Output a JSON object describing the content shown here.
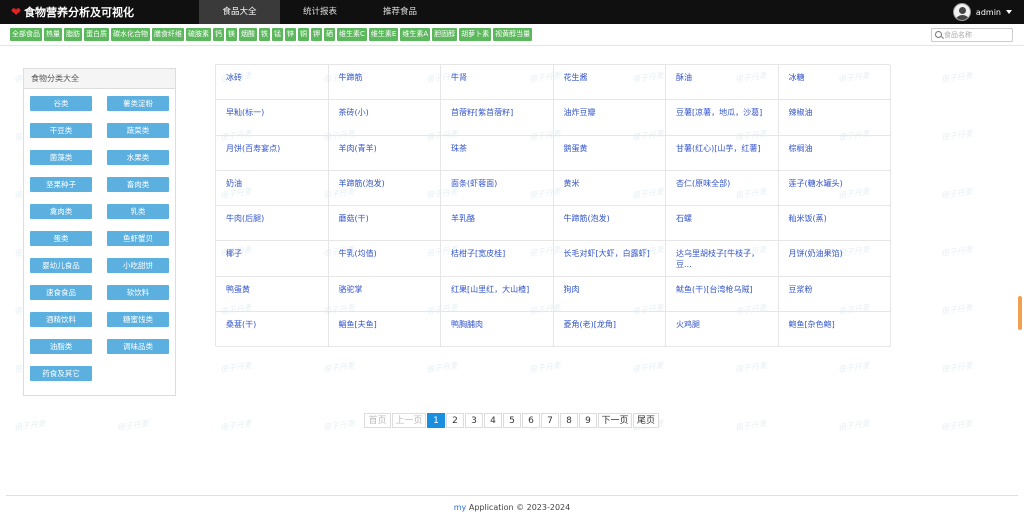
{
  "header": {
    "app_title": "食物营养分析及可视化",
    "tabs": [
      {
        "label": "食品大全",
        "active": true
      },
      {
        "label": "统计报表",
        "active": false
      },
      {
        "label": "推荐食品",
        "active": false
      }
    ],
    "user": {
      "name": "admin"
    }
  },
  "filters": {
    "items": [
      "全部食品",
      "热量",
      "脂肪",
      "蛋白质",
      "碳水化合物",
      "膳食纤维",
      "硫胺素",
      "钙",
      "镁",
      "烟酸",
      "铁",
      "锰",
      "锌",
      "铜",
      "钾",
      "硒",
      "维生素C",
      "维生素E",
      "维生素A",
      "胆固醇",
      "胡萝卜素",
      "视黄醇当量"
    ]
  },
  "search": {
    "placeholder": "食品名称",
    "value": ""
  },
  "sidebar": {
    "title": "食物分类大全",
    "categories": [
      "谷类",
      "薯类淀粉",
      "干豆类",
      "蔬菜类",
      "菌藻类",
      "水果类",
      "坚果种子",
      "畜肉类",
      "禽肉类",
      "乳类",
      "蛋类",
      "鱼虾蟹贝",
      "婴幼儿食品",
      "小吃甜饼",
      "速食食品",
      "软饮料",
      "酒精饮料",
      "糖蜜饯类",
      "油脂类",
      "调味品类",
      "药食及其它"
    ]
  },
  "foods": [
    [
      "冰砖",
      "牛蹄筋",
      "牛肾",
      "花生酱",
      "酥油",
      "冰糖"
    ],
    [
      "早籼(标一)",
      "茶砖(小)",
      "苜蓿籽[紫苜蓿籽]",
      "油炸豆瓣",
      "豆薯[凉薯，地瓜，沙葛]",
      "辣椒油"
    ],
    [
      "月饼(百寿宴点)",
      "羊肉(青羊)",
      "珠茶",
      "鹅蛋黄",
      "甘薯(红心)[山芋，红薯]",
      "棕榈油"
    ],
    [
      "奶油",
      "羊蹄筋(泡发)",
      "面条(虾蓉面)",
      "黄米",
      "杏仁(原味全部)",
      "莲子(糖水罐头)"
    ],
    [
      "牛肉(后腿)",
      "蘑菇(干)",
      "羊乳酪",
      "牛蹄筋(泡发)",
      "石螺",
      "籼米饭(蒸)"
    ],
    [
      "椰子",
      "牛乳(均值)",
      "桔柑子[宽皮桂]",
      "长毛对虾[大虾，白露虾]",
      "达乌里胡枝子[牛枝子，豆...",
      "月饼(奶油果馅)"
    ],
    [
      "鸭蛋黄",
      "骆驼掌",
      "红果[山里红，大山楂]",
      "狗肉",
      "鱿鱼(干)[台湾枪乌贼]",
      "豆浆粉"
    ],
    [
      "桑葚(干)",
      "鲳鱼[夫鱼]",
      "鸭胸脯肉",
      "菱角(老)[龙角]",
      "火鸡腿",
      "鲍鱼[杂色鲍]"
    ]
  ],
  "pagination": {
    "first": "首页",
    "prev": "上一页",
    "pages": [
      "1",
      "2",
      "3",
      "4",
      "5",
      "6",
      "7",
      "8",
      "9"
    ],
    "current": "1",
    "next": "下一页",
    "last": "尾页"
  },
  "footer": {
    "brand": "my",
    "text": "Application © 2023-2024"
  },
  "watermark": {
    "text": "很子丹麦"
  },
  "colors": {
    "navbar": "#101010",
    "filter_chip": "#5cb85c",
    "category_button": "#5bb0e0",
    "food_link": "#3355cc",
    "page_active": "#1a8fe0",
    "logo_heart": "#e02424"
  },
  "icons": {
    "logo": "heart-icon",
    "user": "avatar-icon",
    "menu": "caret-down-icon",
    "search": "search-icon"
  }
}
